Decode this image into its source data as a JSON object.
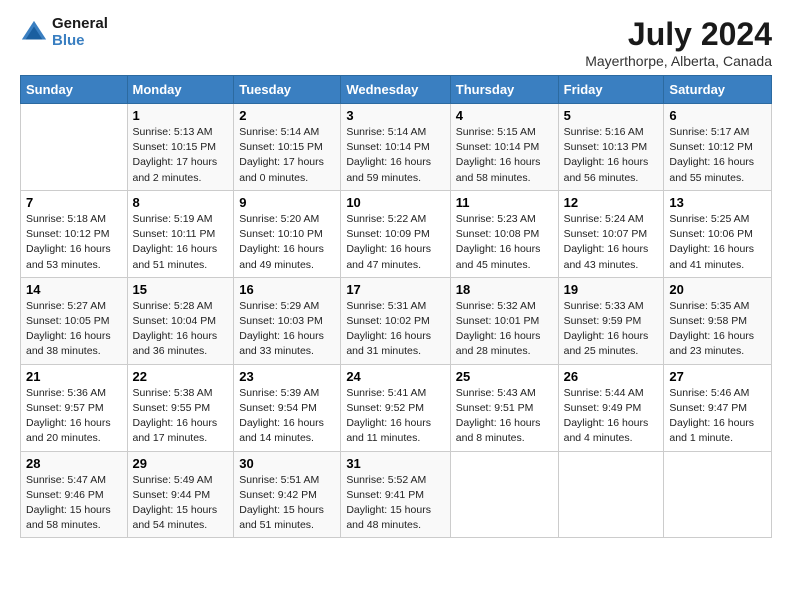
{
  "header": {
    "logo_line1": "General",
    "logo_line2": "Blue",
    "month_title": "July 2024",
    "location": "Mayerthorpe, Alberta, Canada"
  },
  "days_of_week": [
    "Sunday",
    "Monday",
    "Tuesday",
    "Wednesday",
    "Thursday",
    "Friday",
    "Saturday"
  ],
  "weeks": [
    [
      {
        "day": "",
        "detail": ""
      },
      {
        "day": "1",
        "detail": "Sunrise: 5:13 AM\nSunset: 10:15 PM\nDaylight: 17 hours\nand 2 minutes."
      },
      {
        "day": "2",
        "detail": "Sunrise: 5:14 AM\nSunset: 10:15 PM\nDaylight: 17 hours\nand 0 minutes."
      },
      {
        "day": "3",
        "detail": "Sunrise: 5:14 AM\nSunset: 10:14 PM\nDaylight: 16 hours\nand 59 minutes."
      },
      {
        "day": "4",
        "detail": "Sunrise: 5:15 AM\nSunset: 10:14 PM\nDaylight: 16 hours\nand 58 minutes."
      },
      {
        "day": "5",
        "detail": "Sunrise: 5:16 AM\nSunset: 10:13 PM\nDaylight: 16 hours\nand 56 minutes."
      },
      {
        "day": "6",
        "detail": "Sunrise: 5:17 AM\nSunset: 10:12 PM\nDaylight: 16 hours\nand 55 minutes."
      }
    ],
    [
      {
        "day": "7",
        "detail": "Sunrise: 5:18 AM\nSunset: 10:12 PM\nDaylight: 16 hours\nand 53 minutes."
      },
      {
        "day": "8",
        "detail": "Sunrise: 5:19 AM\nSunset: 10:11 PM\nDaylight: 16 hours\nand 51 minutes."
      },
      {
        "day": "9",
        "detail": "Sunrise: 5:20 AM\nSunset: 10:10 PM\nDaylight: 16 hours\nand 49 minutes."
      },
      {
        "day": "10",
        "detail": "Sunrise: 5:22 AM\nSunset: 10:09 PM\nDaylight: 16 hours\nand 47 minutes."
      },
      {
        "day": "11",
        "detail": "Sunrise: 5:23 AM\nSunset: 10:08 PM\nDaylight: 16 hours\nand 45 minutes."
      },
      {
        "day": "12",
        "detail": "Sunrise: 5:24 AM\nSunset: 10:07 PM\nDaylight: 16 hours\nand 43 minutes."
      },
      {
        "day": "13",
        "detail": "Sunrise: 5:25 AM\nSunset: 10:06 PM\nDaylight: 16 hours\nand 41 minutes."
      }
    ],
    [
      {
        "day": "14",
        "detail": "Sunrise: 5:27 AM\nSunset: 10:05 PM\nDaylight: 16 hours\nand 38 minutes."
      },
      {
        "day": "15",
        "detail": "Sunrise: 5:28 AM\nSunset: 10:04 PM\nDaylight: 16 hours\nand 36 minutes."
      },
      {
        "day": "16",
        "detail": "Sunrise: 5:29 AM\nSunset: 10:03 PM\nDaylight: 16 hours\nand 33 minutes."
      },
      {
        "day": "17",
        "detail": "Sunrise: 5:31 AM\nSunset: 10:02 PM\nDaylight: 16 hours\nand 31 minutes."
      },
      {
        "day": "18",
        "detail": "Sunrise: 5:32 AM\nSunset: 10:01 PM\nDaylight: 16 hours\nand 28 minutes."
      },
      {
        "day": "19",
        "detail": "Sunrise: 5:33 AM\nSunset: 9:59 PM\nDaylight: 16 hours\nand 25 minutes."
      },
      {
        "day": "20",
        "detail": "Sunrise: 5:35 AM\nSunset: 9:58 PM\nDaylight: 16 hours\nand 23 minutes."
      }
    ],
    [
      {
        "day": "21",
        "detail": "Sunrise: 5:36 AM\nSunset: 9:57 PM\nDaylight: 16 hours\nand 20 minutes."
      },
      {
        "day": "22",
        "detail": "Sunrise: 5:38 AM\nSunset: 9:55 PM\nDaylight: 16 hours\nand 17 minutes."
      },
      {
        "day": "23",
        "detail": "Sunrise: 5:39 AM\nSunset: 9:54 PM\nDaylight: 16 hours\nand 14 minutes."
      },
      {
        "day": "24",
        "detail": "Sunrise: 5:41 AM\nSunset: 9:52 PM\nDaylight: 16 hours\nand 11 minutes."
      },
      {
        "day": "25",
        "detail": "Sunrise: 5:43 AM\nSunset: 9:51 PM\nDaylight: 16 hours\nand 8 minutes."
      },
      {
        "day": "26",
        "detail": "Sunrise: 5:44 AM\nSunset: 9:49 PM\nDaylight: 16 hours\nand 4 minutes."
      },
      {
        "day": "27",
        "detail": "Sunrise: 5:46 AM\nSunset: 9:47 PM\nDaylight: 16 hours\nand 1 minute."
      }
    ],
    [
      {
        "day": "28",
        "detail": "Sunrise: 5:47 AM\nSunset: 9:46 PM\nDaylight: 15 hours\nand 58 minutes."
      },
      {
        "day": "29",
        "detail": "Sunrise: 5:49 AM\nSunset: 9:44 PM\nDaylight: 15 hours\nand 54 minutes."
      },
      {
        "day": "30",
        "detail": "Sunrise: 5:51 AM\nSunset: 9:42 PM\nDaylight: 15 hours\nand 51 minutes."
      },
      {
        "day": "31",
        "detail": "Sunrise: 5:52 AM\nSunset: 9:41 PM\nDaylight: 15 hours\nand 48 minutes."
      },
      {
        "day": "",
        "detail": ""
      },
      {
        "day": "",
        "detail": ""
      },
      {
        "day": "",
        "detail": ""
      }
    ]
  ]
}
